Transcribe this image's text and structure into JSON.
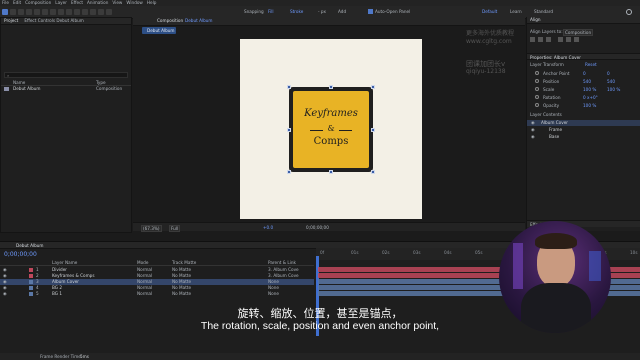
{
  "menu": [
    "File",
    "Edit",
    "Composition",
    "Layer",
    "Effect",
    "Animation",
    "View",
    "Window",
    "Help"
  ],
  "toolbar": {
    "snapping": "Snapping",
    "fill": "Fill",
    "stroke": "Stroke",
    "stroke_size": "- px",
    "add": "Add",
    "auto_open": "Auto-Open Panel",
    "workspace_default": "Default",
    "workspace_learn": "Learn",
    "workspace_other": "Standard",
    "search": "Search Help"
  },
  "project_panel": {
    "tab": "Project",
    "effects_tab": "Effect Controls Debut Album",
    "search_placeholder": "",
    "col_name": "Name",
    "col_type": "Type",
    "item_name": "Debut Album",
    "item_type": "Composition"
  },
  "comp_panel": {
    "tab": "Composition",
    "tab_name": "Debut Album",
    "breadcrumb": "Debut Album",
    "zoom": "(67.3%)",
    "resolution": "Full",
    "timecode": "0;00;00;00",
    "plus": "+0.0"
  },
  "artwork": {
    "line1": "Keyframes",
    "amp": "&",
    "line2": "Comps"
  },
  "watermark": {
    "line1": "更多海外优质教程",
    "line2": "www.cgltg.com",
    "line3": "团课加团长v",
    "line4": "qiqiyu-12138"
  },
  "align_panel": {
    "title": "Align",
    "align_to_label": "Align Layers to:",
    "align_to_value": "Composition"
  },
  "properties": {
    "title": "Properties: Album Cover",
    "section": "Layer Transform",
    "reset": "Reset",
    "rows": [
      {
        "label": "Anchor Point",
        "v1": "0",
        "v2": "0"
      },
      {
        "label": "Position",
        "v1": "540",
        "v2": "540"
      },
      {
        "label": "Scale",
        "v1": "100 %",
        "v2": "100 %"
      },
      {
        "label": "Rotation",
        "v1": "0 x+0°",
        "v2": ""
      },
      {
        "label": "Opacity",
        "v1": "100 %",
        "v2": ""
      }
    ],
    "contents_title": "Layer Contents",
    "contents": [
      "Album Cover",
      "Frame",
      "Base"
    ]
  },
  "effects_panel": {
    "title": "Effects & Presets"
  },
  "timeline": {
    "tab": "Debut Album",
    "timecode": "0;00;00;00",
    "col_layer": "Layer Name",
    "col_mode": "Mode",
    "col_trkmat": "Track Matte",
    "col_parent": "Parent & Link",
    "layers": [
      {
        "num": "1",
        "name": "Divider",
        "mode": "Normal",
        "matte": "No Matte",
        "parent": "3. Album Cove",
        "color": "#c0485c"
      },
      {
        "num": "2",
        "name": "Keyframes & Comps",
        "mode": "Normal",
        "matte": "No Matte",
        "parent": "3. Album Cove",
        "color": "#c0485c"
      },
      {
        "num": "3",
        "name": "Album Cover",
        "mode": "Normal",
        "matte": "No Matte",
        "parent": "None",
        "color": "#5b78a6"
      },
      {
        "num": "4",
        "name": "BG 2",
        "mode": "Normal",
        "matte": "No Matte",
        "parent": "None",
        "color": "#5b78a6"
      },
      {
        "num": "5",
        "name": "BG 1",
        "mode": "Normal",
        "matte": "No Matte",
        "parent": "None",
        "color": "#5b78a6"
      }
    ],
    "ruler_ticks": [
      "0f",
      "01s",
      "02s",
      "03s",
      "04s",
      "05s",
      "06s",
      "07s",
      "08s",
      "09s",
      "10s"
    ]
  },
  "subtitle": {
    "zh": "旋转、缩放、位置，甚至是锚点，",
    "en": "The rotation, scale, position and even anchor point,"
  },
  "status": {
    "render_label": "Frame Render Time:",
    "render_value": "5ms"
  }
}
